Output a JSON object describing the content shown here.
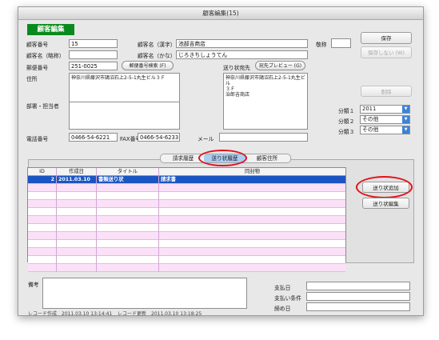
{
  "window": {
    "title": "顧客編集(15)"
  },
  "header": {
    "badge": "顧客編集"
  },
  "customer": {
    "number_label": "顧客番号",
    "number": "15",
    "short_name_label": "顧客名（略称）",
    "short_name": "",
    "name_kanji_label": "顧客名（漢字）",
    "name_kanji": "池部吉商店",
    "name_kana_label": "顧客名（かな）",
    "name_kana": "じろきちしょうてん",
    "honorific_label": "敬称",
    "honorific": "",
    "postal_label": "郵便番号",
    "postal": "251-0025",
    "postal_search_label": "郵便番号検索 (F)",
    "address_label": "住所",
    "address": "神奈川県藤沢市鵠沼石上2-5-1丸生ビル３Ｆ",
    "dept_label": "部署・担当者",
    "dept": "",
    "phone_label": "電話番号",
    "phone": "0466-54-6221",
    "fax_label": "FAX番号",
    "fax": "0466-54-6233",
    "email_label": "メール",
    "email": "",
    "shipto_label": "送り状宛先",
    "shipto_preview_label": "宛先プレビュー (G)",
    "shipto_lines": [
      "神奈川県藤沢市鵠沼石上2-5-1丸生ビル",
      "３Ｆ",
      "治郎吉商店"
    ]
  },
  "actions": {
    "save": "保存",
    "nosave": "保存しない (W)",
    "delete": "削除"
  },
  "classify": [
    {
      "label": "分類１",
      "value": "2011"
    },
    {
      "label": "分類２",
      "value": "その他"
    },
    {
      "label": "分類３",
      "value": "その他"
    }
  ],
  "tabs": [
    {
      "label": "請求履歴",
      "active": false
    },
    {
      "label": "送り状履歴",
      "active": true
    },
    {
      "label": "顧客住所",
      "active": false
    }
  ],
  "grid": {
    "columns": [
      "ID",
      "作成日",
      "タイトル",
      "同封物"
    ],
    "rows": [
      {
        "id": "2",
        "date": "2011.03.10",
        "title": "書類送り状",
        "enclosure": "請求書",
        "selected": true
      }
    ],
    "empty_rows": 11
  },
  "side_buttons": {
    "add": "送り状追加",
    "edit": "送り状編集"
  },
  "bottom": {
    "memo_label": "備考",
    "memo": "",
    "pay_date_label": "支払日",
    "pay_date": "",
    "pay_terms_label": "支払い条件",
    "pay_terms": "",
    "close_date_label": "締め日",
    "close_date": ""
  },
  "footer": {
    "created": "レコード作成　2011.03.10 13:14:41",
    "updated": "レコード更新　2011.03.10 13:18:25"
  },
  "colors": {
    "badge": "#0a8a1e",
    "selection": "#1b55c4",
    "highlight": "#e0111b",
    "row_tint": "#fbe1f7"
  }
}
